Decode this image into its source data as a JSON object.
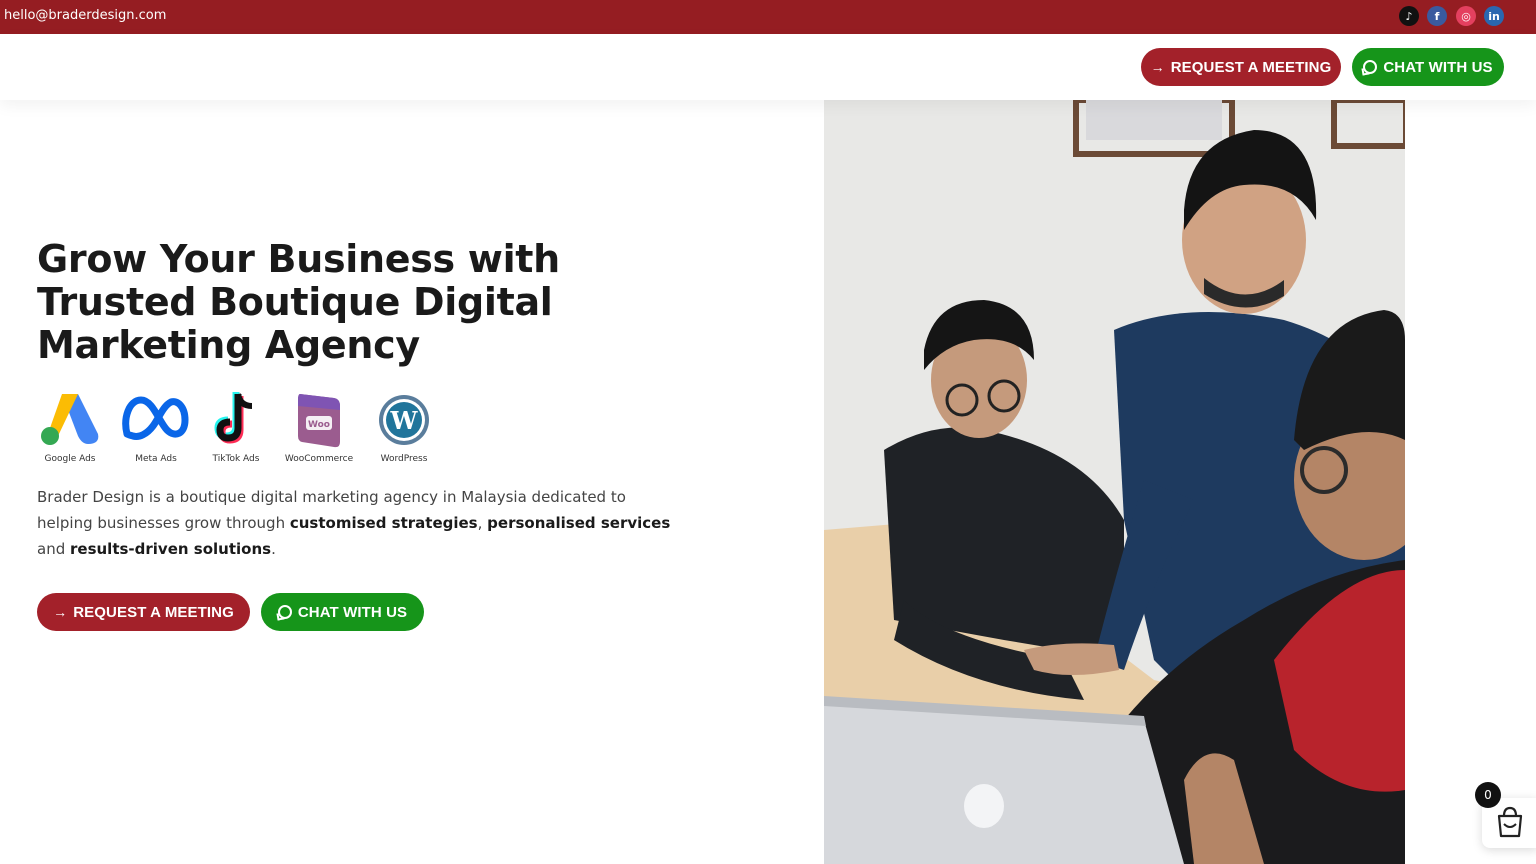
{
  "topbar": {
    "email": "hello@braderdesign.com",
    "social": [
      "tiktok-icon",
      "facebook-icon",
      "instagram-icon",
      "linkedin-icon"
    ],
    "background": "#951d22"
  },
  "header": {
    "meeting_label": "REQUEST A MEETING",
    "chat_label": "CHAT WITH US"
  },
  "hero": {
    "headline": "Grow Your Business with Trusted Boutique Digital Marketing Agency",
    "platforms": [
      {
        "name": "Google Ads",
        "icon": "google-ads-icon"
      },
      {
        "name": "Meta Ads",
        "icon": "meta-icon"
      },
      {
        "name": "TikTok Ads",
        "icon": "tiktok-icon"
      },
      {
        "name": "WooCommerce",
        "icon": "woocommerce-icon"
      },
      {
        "name": "WordPress",
        "icon": "wordpress-icon"
      }
    ],
    "description": {
      "part1": "Brader Design is a boutique digital marketing agency in Malaysia dedicated to helping businesses grow through ",
      "bold1": "customised strategies",
      "sep1": ", ",
      "bold2": "personalised services",
      "sep2": " and ",
      "bold3": "results-driven solutions",
      "end": "."
    },
    "meeting_label": "REQUEST A MEETING",
    "chat_label": "CHAT WITH US"
  },
  "cart": {
    "count": "0"
  },
  "colors": {
    "red": "#a3212a",
    "green": "#16951a"
  }
}
